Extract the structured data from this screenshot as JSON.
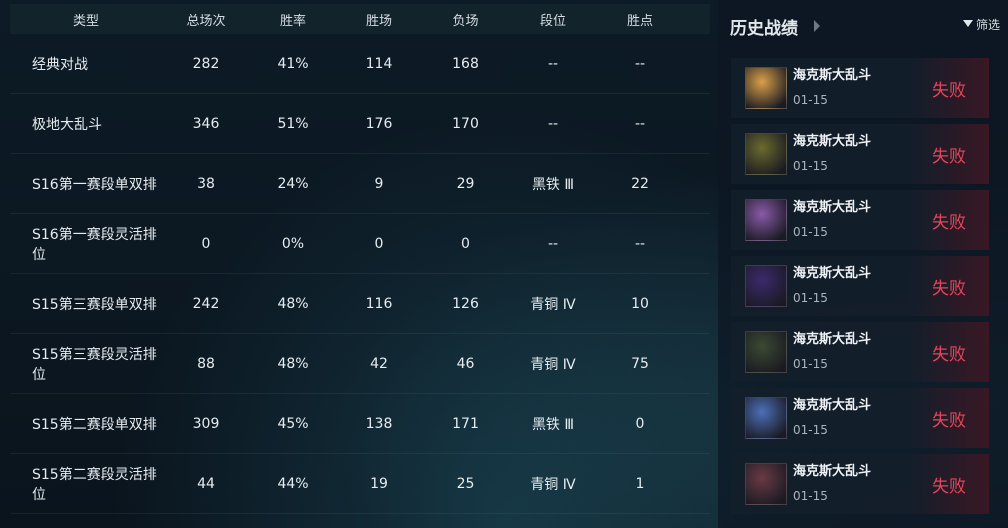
{
  "stats": {
    "headers": [
      "类型",
      "总场次",
      "胜率",
      "胜场",
      "负场",
      "段位",
      "胜点"
    ],
    "rows": [
      [
        "经典对战",
        "282",
        "41%",
        "114",
        "168",
        "--",
        "--"
      ],
      [
        "极地大乱斗",
        "346",
        "51%",
        "176",
        "170",
        "--",
        "--"
      ],
      [
        "S16第一赛段单双排",
        "38",
        "24%",
        "9",
        "29",
        "黑铁 Ⅲ",
        "22"
      ],
      [
        "S16第一赛段灵活排位",
        "0",
        "0%",
        "0",
        "0",
        "--",
        "--"
      ],
      [
        "S15第三赛段单双排",
        "242",
        "48%",
        "116",
        "126",
        "青铜 Ⅳ",
        "10"
      ],
      [
        "S15第三赛段灵活排位",
        "88",
        "48%",
        "42",
        "46",
        "青铜 Ⅳ",
        "75"
      ],
      [
        "S15第二赛段单双排",
        "309",
        "45%",
        "138",
        "171",
        "黑铁 Ⅲ",
        "0"
      ],
      [
        "S15第二赛段灵活排位",
        "44",
        "44%",
        "19",
        "25",
        "青铜 Ⅳ",
        "1"
      ]
    ]
  },
  "history": {
    "title": "历史战绩",
    "filter_label": "筛选",
    "matches": [
      {
        "mode": "海克斯大乱斗",
        "date": "01-15",
        "result": "失败",
        "avatar_color": "#d8a04a"
      },
      {
        "mode": "海克斯大乱斗",
        "date": "01-15",
        "result": "失败",
        "avatar_color": "#6b6a2e"
      },
      {
        "mode": "海克斯大乱斗",
        "date": "01-15",
        "result": "失败",
        "avatar_color": "#8a5aa8"
      },
      {
        "mode": "海克斯大乱斗",
        "date": "01-15",
        "result": "失败",
        "avatar_color": "#3b2a6e"
      },
      {
        "mode": "海克斯大乱斗",
        "date": "01-15",
        "result": "失败",
        "avatar_color": "#3a4a32"
      },
      {
        "mode": "海克斯大乱斗",
        "date": "01-15",
        "result": "失败",
        "avatar_color": "#4c6fb8"
      },
      {
        "mode": "海克斯大乱斗",
        "date": "01-15",
        "result": "失败",
        "avatar_color": "#6a3a44"
      }
    ]
  }
}
